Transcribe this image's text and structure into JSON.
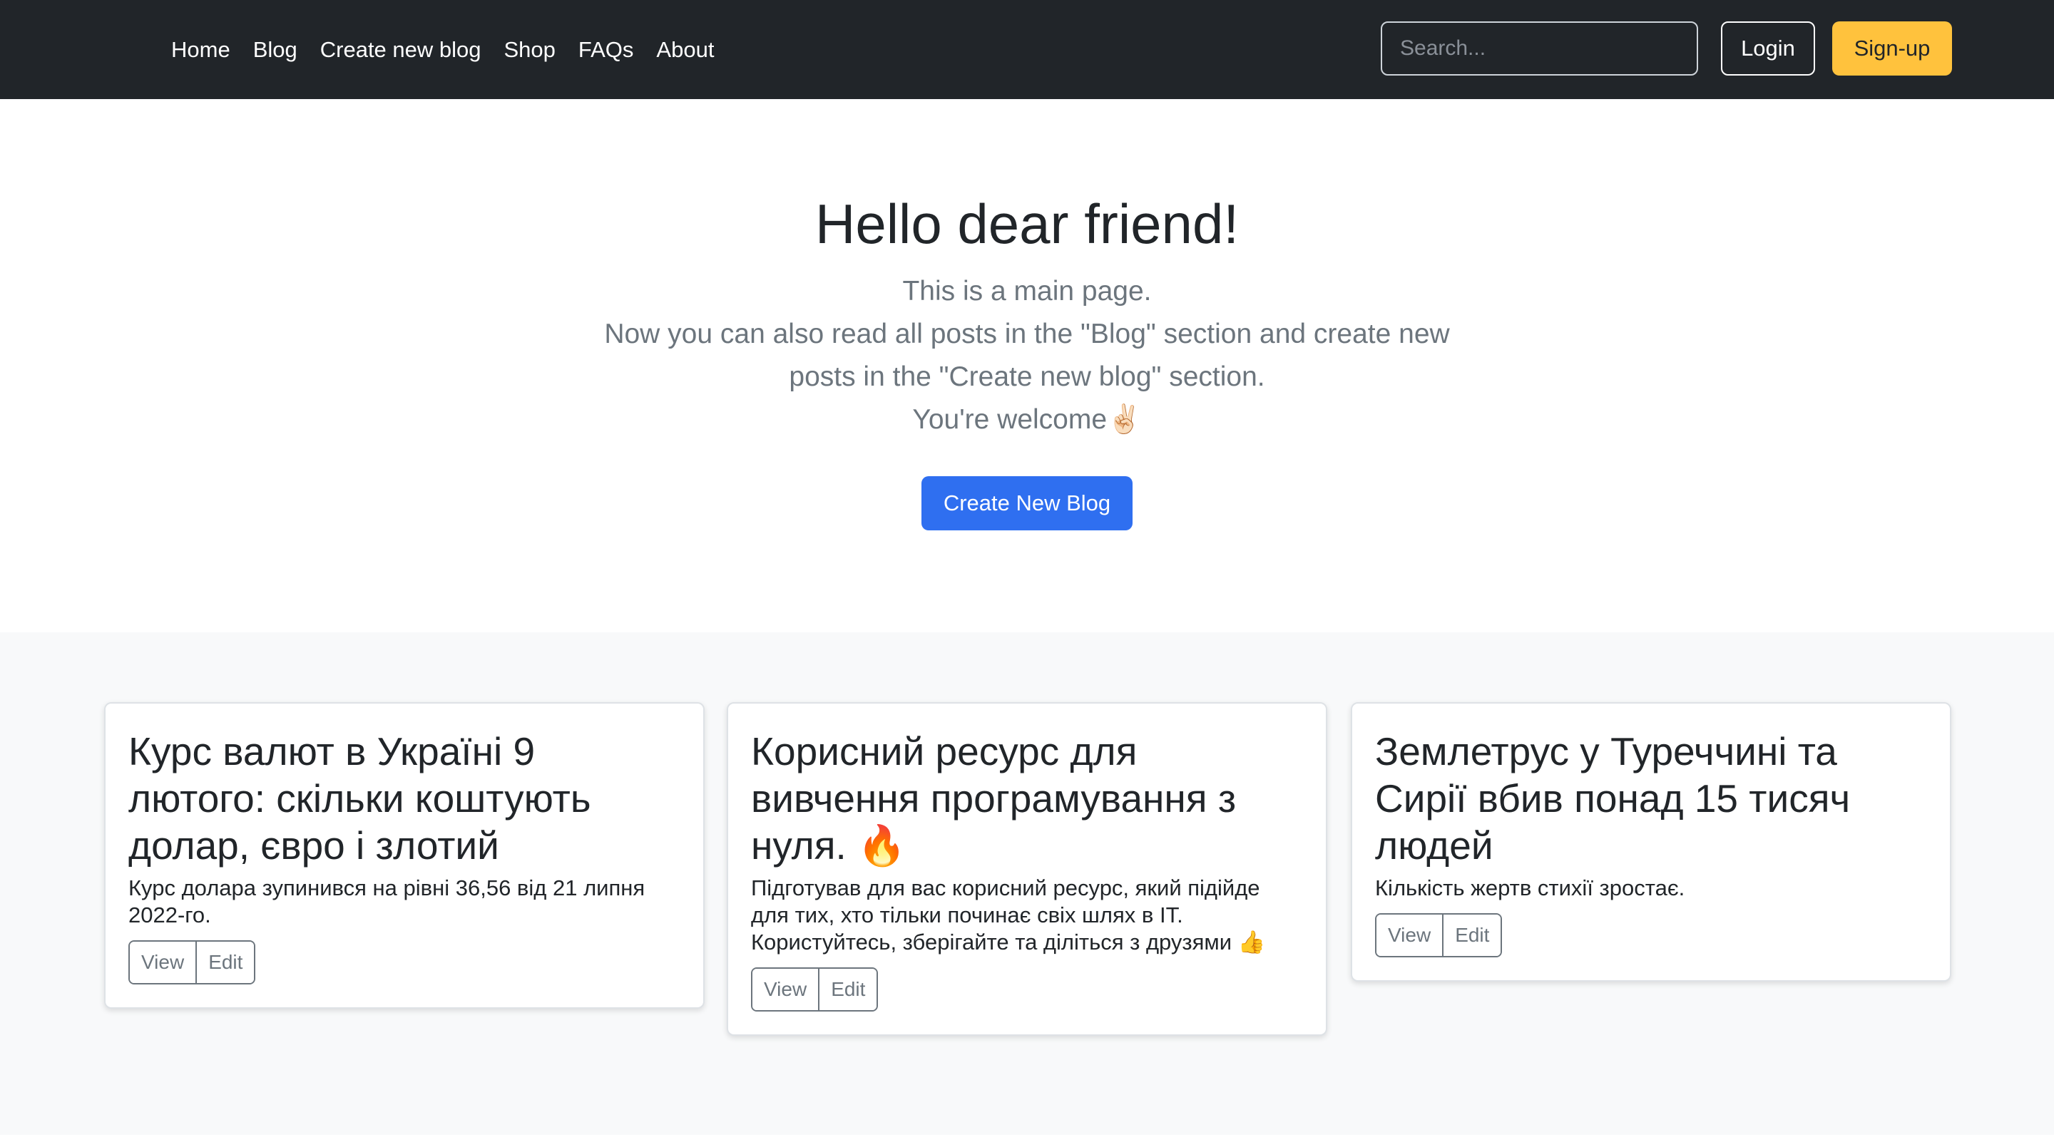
{
  "nav": {
    "links": [
      "Home",
      "Blog",
      "Create new blog",
      "Shop",
      "FAQs",
      "About"
    ],
    "search_placeholder": "Search...",
    "login_label": "Login",
    "signup_label": "Sign-up"
  },
  "hero": {
    "title": "Hello dear friend!",
    "lead_lines": [
      "This is a main page.",
      "Now you can also read all posts in the \"Blog\" section and create new posts in the \"Create new blog\" section.",
      "You're welcome✌🏻"
    ],
    "cta_label": "Create New Blog"
  },
  "cards": [
    {
      "title": "Курс валют в Україні 9 лютого: скільки коштують долар, євро і злотий",
      "text": "Курс долара зупинився на рівні 36,56 від 21 липня 2022-го.",
      "view_label": "View",
      "edit_label": "Edit"
    },
    {
      "title": "Корисний ресурс для вивчення програмування з нуля. 🔥",
      "text": "Підготував для вас корисний ресурс, який підійде для тих, хто тільки починає свіх шлях в ІТ. Користуйтесь, зберігайте та діліться з друзями 👍",
      "view_label": "View",
      "edit_label": "Edit"
    },
    {
      "title": "Землетрус у Туреччині та Сирії вбив понад 15 тисяч людей",
      "text": "Кількість жертв стихії зростає.",
      "view_label": "View",
      "edit_label": "Edit"
    }
  ],
  "colors": {
    "navbar_bg": "#212529",
    "signup_bg": "#ffc23d",
    "primary": "#2f6ff0",
    "muted_text": "#6c757d",
    "section_bg": "#f8f9fa"
  }
}
